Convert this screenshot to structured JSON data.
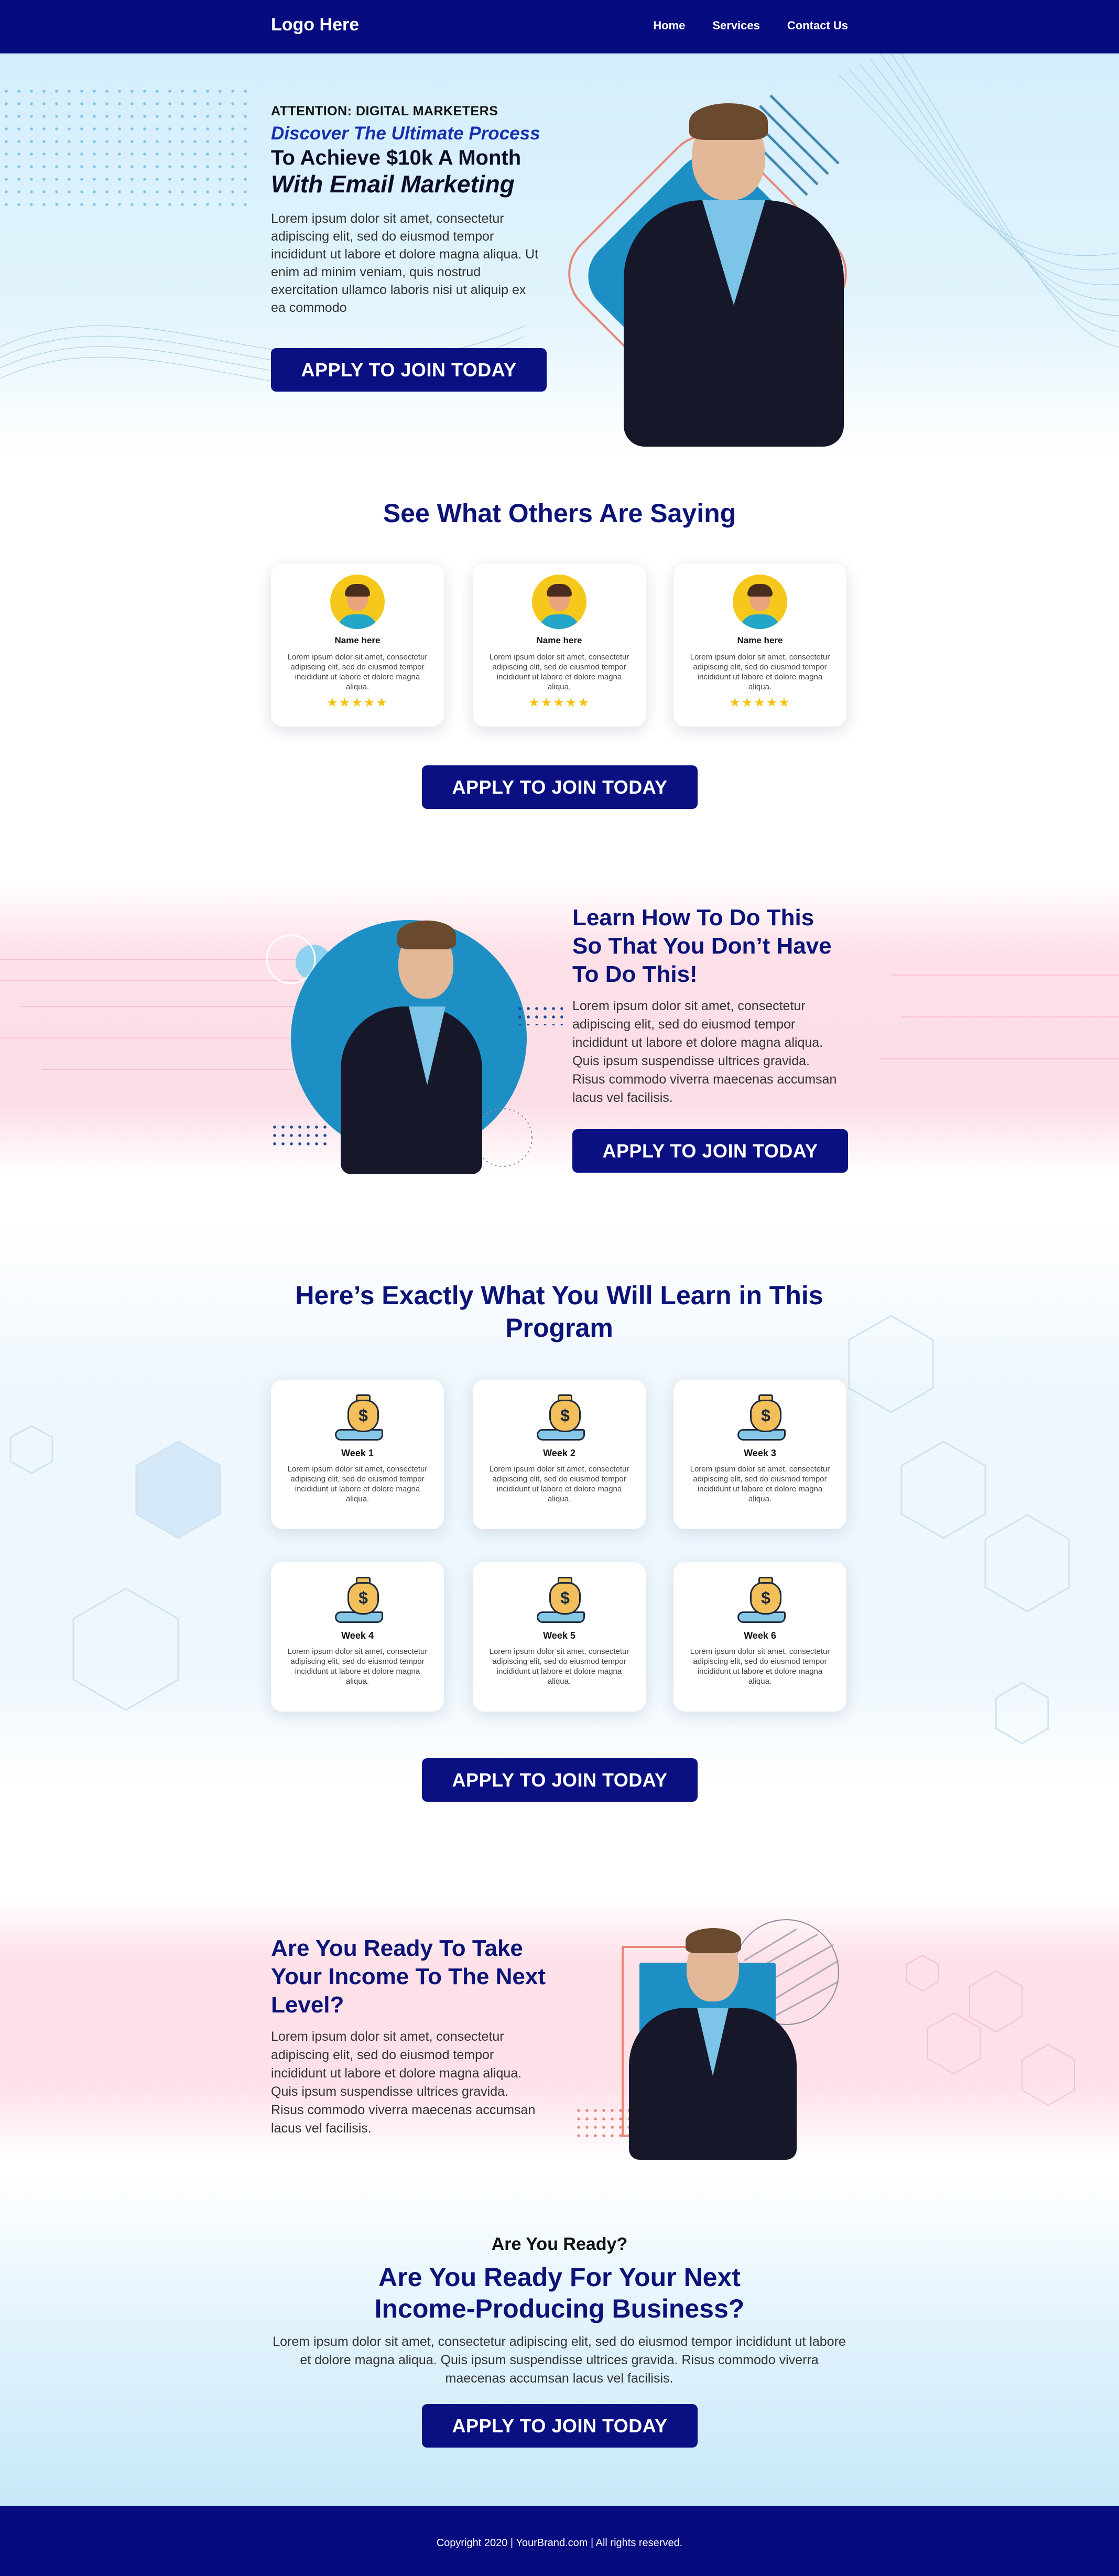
{
  "header": {
    "logo": "Logo Here",
    "nav": [
      "Home",
      "Services",
      "Contact Us"
    ]
  },
  "hero": {
    "attention": "ATTENTION: DIGITAL MARKETERS",
    "discover": "Discover The Ultimate Process",
    "achieve": "To Achieve $10k A Month",
    "email_marketing": "With Email Marketing",
    "body": "Lorem ipsum dolor sit amet, consectetur adipiscing elit, sed do eiusmod tempor incididunt ut labore et dolore magna aliqua. Ut enim ad minim veniam, quis nostrud exercitation ullamco laboris nisi ut aliquip ex ea commodo",
    "cta": "APPLY TO JOIN TODAY"
  },
  "testimonials": {
    "title": "See What Others Are Saying",
    "cards": [
      {
        "name": "Name here",
        "text": "Lorem ipsum dolor sit amet, consectetur adipiscing elit, sed do eiusmod tempor incididunt ut labore et dolore magna aliqua.",
        "stars": "★★★★★"
      },
      {
        "name": "Name here",
        "text": "Lorem ipsum dolor sit amet, consectetur adipiscing elit, sed do eiusmod tempor incididunt ut labore et dolore magna aliqua.",
        "stars": "★★★★★"
      },
      {
        "name": "Name here",
        "text": "Lorem ipsum dolor sit amet, consectetur adipiscing elit, sed do eiusmod tempor incididunt ut labore et dolore magna aliqua.",
        "stars": "★★★★★"
      }
    ],
    "cta": "APPLY TO JOIN TODAY"
  },
  "learn": {
    "title": "Learn How To Do This So That You Don’t Have To Do This!",
    "body": "Lorem ipsum dolor sit amet, consectetur adipiscing elit, sed do eiusmod tempor incididunt ut labore et dolore magna aliqua. Quis ipsum suspendisse ultrices gravida. Risus commodo viverra maecenas accumsan lacus vel facilisis.",
    "cta": "APPLY TO JOIN TODAY"
  },
  "program": {
    "title": "Here’s Exactly What You Will Learn in This Program",
    "weeks": [
      {
        "label": "Week 1",
        "text": "Lorem ipsum dolor sit amet, consectetur adipiscing elit, sed do eiusmod tempor incididunt ut labore et dolore magna aliqua."
      },
      {
        "label": "Week 2",
        "text": "Lorem ipsum dolor sit amet, consectetur adipiscing elit, sed do eiusmod tempor incididunt ut labore et dolore magna aliqua."
      },
      {
        "label": "Week 3",
        "text": "Lorem ipsum dolor sit amet, consectetur adipiscing elit, sed do eiusmod tempor incididunt ut labore et dolore magna aliqua."
      },
      {
        "label": "Week 4",
        "text": "Lorem ipsum dolor sit amet, consectetur adipiscing elit, sed do eiusmod tempor incididunt ut labore et dolore magna aliqua."
      },
      {
        "label": "Week 5",
        "text": "Lorem ipsum dolor sit amet, consectetur adipiscing elit, sed do eiusmod tempor incididunt ut labore et dolore magna aliqua."
      },
      {
        "label": "Week 6",
        "text": "Lorem ipsum dolor sit amet, consectetur adipiscing elit, sed do eiusmod tempor incididunt ut labore et dolore magna aliqua."
      }
    ],
    "cta": "APPLY TO JOIN TODAY"
  },
  "ready": {
    "title": "Are You Ready To Take Your Income To The Next Level?",
    "body": "Lorem ipsum dolor sit amet, consectetur adipiscing elit, sed do eiusmod tempor incididunt ut labore et dolore magna aliqua. Quis ipsum suspendisse ultrices gravida. Risus commodo viverra maecenas accumsan lacus vel facilisis."
  },
  "final": {
    "pre": "Are You Ready?",
    "title_line1": "Are You Ready For Your Next",
    "title_line2": "Income-Producing Business?",
    "body": "Lorem ipsum dolor sit amet, consectetur adipiscing elit, sed do eiusmod tempor incididunt ut labore et dolore magna aliqua. Quis ipsum suspendisse ultrices gravida. Risus commodo viverra maecenas accumsan lacus vel facilisis.",
    "cta": "APPLY TO JOIN TODAY"
  },
  "footer": {
    "copyright": "Copyright 2020 | YourBrand.com | All rights reserved."
  },
  "colors": {
    "navy": "#070b80",
    "heading": "#0c1378",
    "accent_blue": "#1e8fc4",
    "accent_coral": "#e8867a",
    "star": "#f4c20d"
  }
}
